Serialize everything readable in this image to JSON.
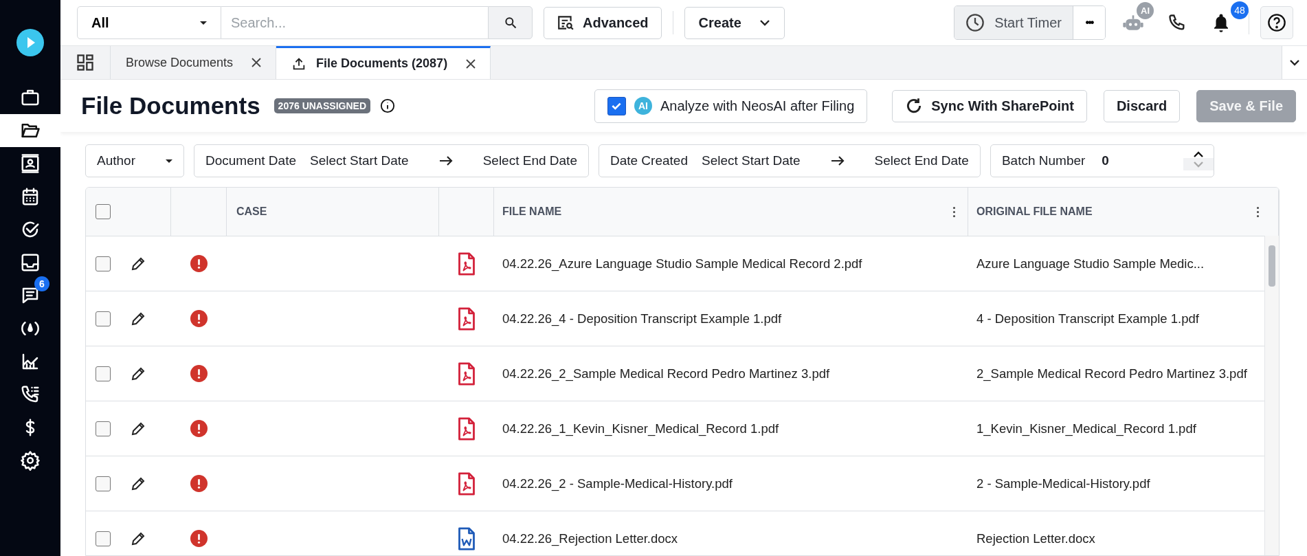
{
  "sidebar": {
    "items": [
      {
        "selected": false
      },
      {
        "selected": true
      },
      {
        "selected": false
      },
      {
        "selected": false
      },
      {
        "selected": false
      },
      {
        "selected": false
      },
      {
        "selected": false,
        "badge": "6"
      },
      {
        "selected": false
      },
      {
        "selected": false
      },
      {
        "selected": false
      },
      {
        "selected": false
      },
      {
        "selected": false
      }
    ]
  },
  "topbar": {
    "scope": "All",
    "search_placeholder": "Search...",
    "advanced": "Advanced",
    "create": "Create",
    "timer": "Start Timer",
    "more": "•••",
    "ai_badge": "AI",
    "notifications": "48"
  },
  "tabs": [
    {
      "label": "Browse Documents",
      "selected": false
    },
    {
      "label": "File Documents (2087)",
      "selected": true
    }
  ],
  "header": {
    "title": "File Documents",
    "badge": "2076 UNASSIGNED",
    "analyze": {
      "label": "Analyze with NeosAI after Filing",
      "checked": true,
      "ai": "AI"
    },
    "sync": "Sync With SharePoint",
    "discard": "Discard",
    "save": {
      "label": "Save & File",
      "disabled": true
    }
  },
  "filters": {
    "author": "Author",
    "ranges": [
      {
        "label": "Document Date",
        "start": "Select Start Date",
        "end": "Select End Date"
      },
      {
        "label": "Date Created",
        "start": "Select Start Date",
        "end": "Select End Date"
      }
    ],
    "batch": {
      "label": "Batch Number",
      "value": "0"
    }
  },
  "table": {
    "columns": [
      "CASE",
      "FILE NAME",
      "ORIGINAL FILE NAME"
    ],
    "all_checked": false,
    "rows": [
      {
        "checked": false,
        "kind": "pdf",
        "file_name": "04.22.26_Azure Language Studio Sample Medical Record 2.pdf",
        "original": "Azure Language Studio Sample Medic..."
      },
      {
        "checked": false,
        "kind": "pdf",
        "file_name": "04.22.26_4 - Deposition Transcript Example 1.pdf",
        "original": "4 - Deposition Transcript Example 1.pdf"
      },
      {
        "checked": false,
        "kind": "pdf",
        "file_name": "04.22.26_2_Sample Medical Record Pedro Martinez 3.pdf",
        "original": "2_Sample Medical Record Pedro Martinez 3.pdf"
      },
      {
        "checked": false,
        "kind": "pdf",
        "file_name": "04.22.26_1_Kevin_Kisner_Medical_Record 1.pdf",
        "original": "1_Kevin_Kisner_Medical_Record 1.pdf"
      },
      {
        "checked": false,
        "kind": "pdf",
        "file_name": "04.22.26_2 - Sample-Medical-History.pdf",
        "original": "2 - Sample-Medical-History.pdf"
      },
      {
        "checked": false,
        "kind": "docx",
        "file_name": "04.22.26_Rejection Letter.docx",
        "original": "Rejection Letter.docx"
      }
    ]
  }
}
